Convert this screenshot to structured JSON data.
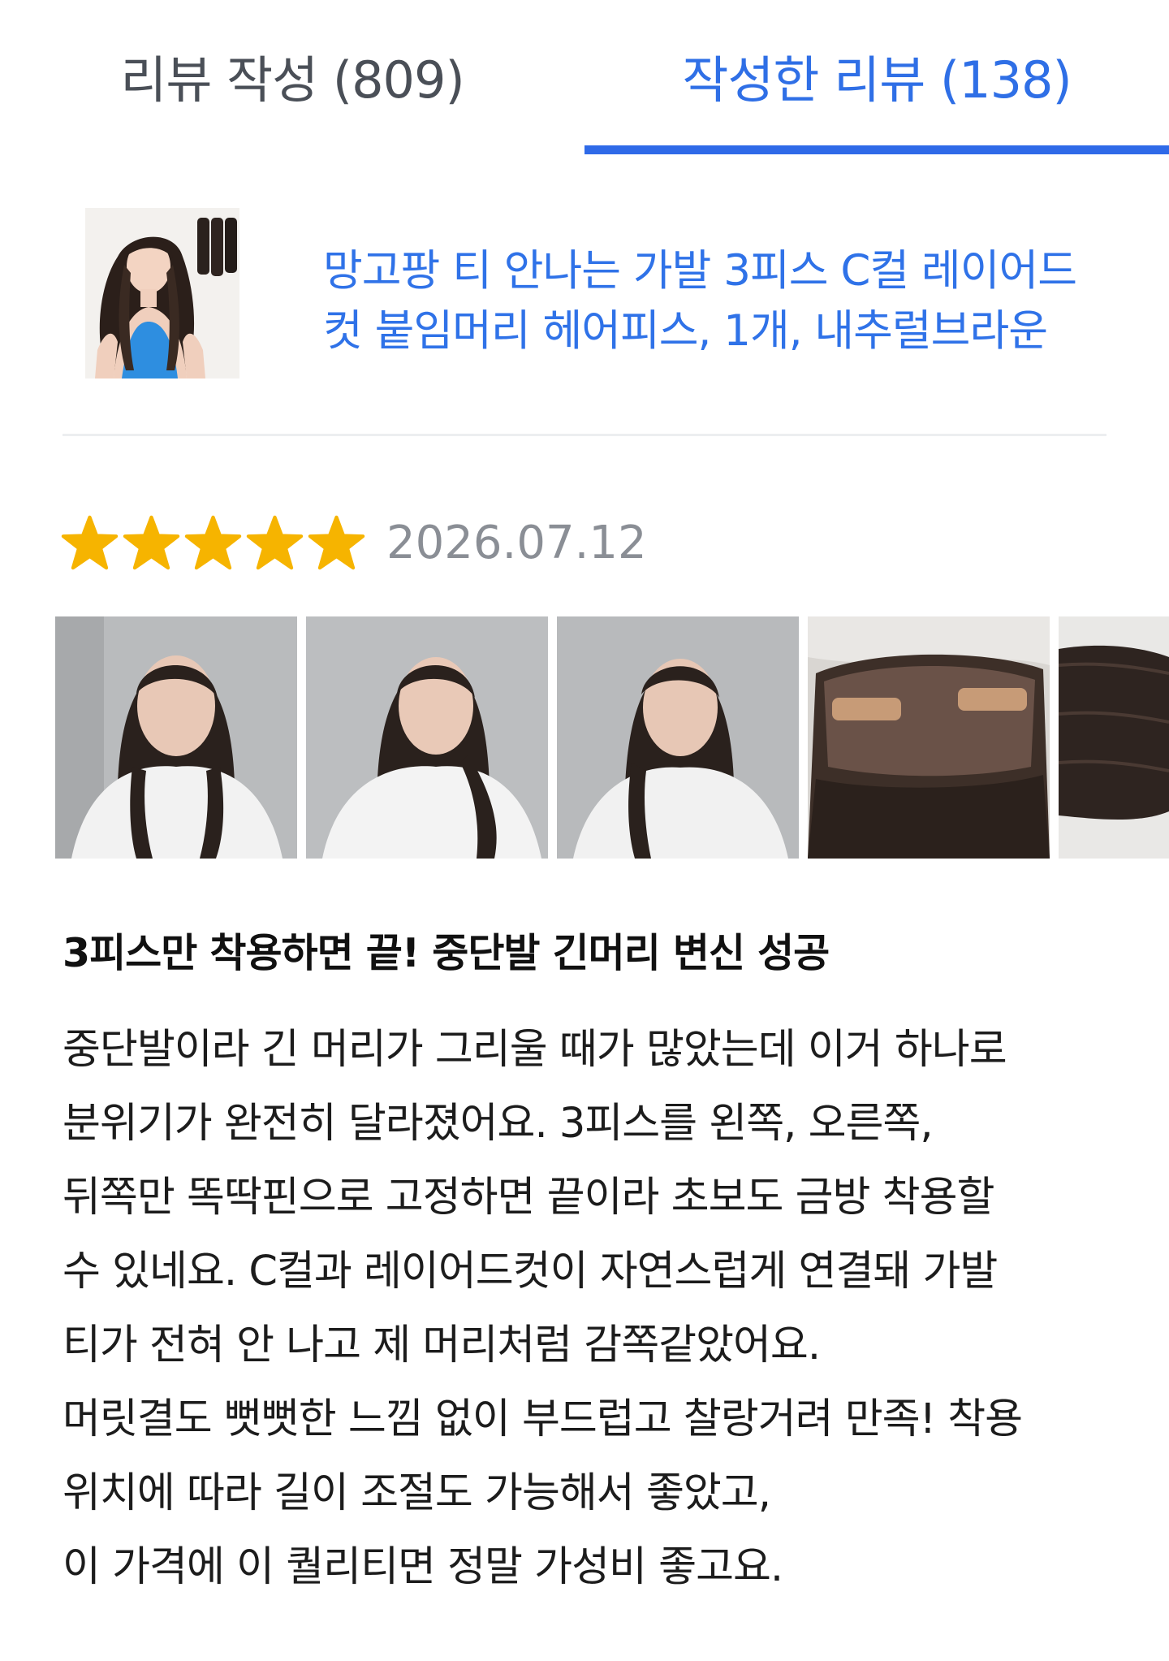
{
  "tabs": {
    "write_label": "리뷰 작성 (809)",
    "written_label": "작성한 리뷰 (138)",
    "active": "written",
    "accent_color": "#2f6ae8"
  },
  "product": {
    "name": "망고팡 티 안나는 가발 3피스 C컬 레이어드컷 붙임머리 헤어피스, 1개, 내추럴브라운",
    "thumbnail_icon": "product-photo-woman-hair"
  },
  "review": {
    "rating": 5,
    "max_rating": 5,
    "star_color": "#f6b400",
    "date": "2026.07.12",
    "photos": [
      "photo-1",
      "photo-2",
      "photo-3",
      "photo-4",
      "photo-5"
    ],
    "title": "3피스만 착용하면 끝! 중단발 긴머리 변신 성공",
    "body_lines": [
      "중단발이라 긴 머리가 그리울 때가 많았는데 이거 하나로",
      "분위기가 완전히 달라졌어요. 3피스를 왼쪽, 오른쪽,",
      "뒤쪽만 똑딱핀으로 고정하면 끝이라 초보도 금방 착용할",
      "수 있네요. C컬과 레이어드컷이 자연스럽게 연결돼 가발",
      "티가 전혀 안 나고 제 머리처럼 감쪽같았어요.",
      "머릿결도 뻣뻣한 느낌 없이 부드럽고 찰랑거려 만족! 착용",
      "위치에 따라 길이 조절도 가능해서 좋았고,",
      "이 가격에 이 퀄리티면 정말 가성비 좋고요."
    ]
  }
}
